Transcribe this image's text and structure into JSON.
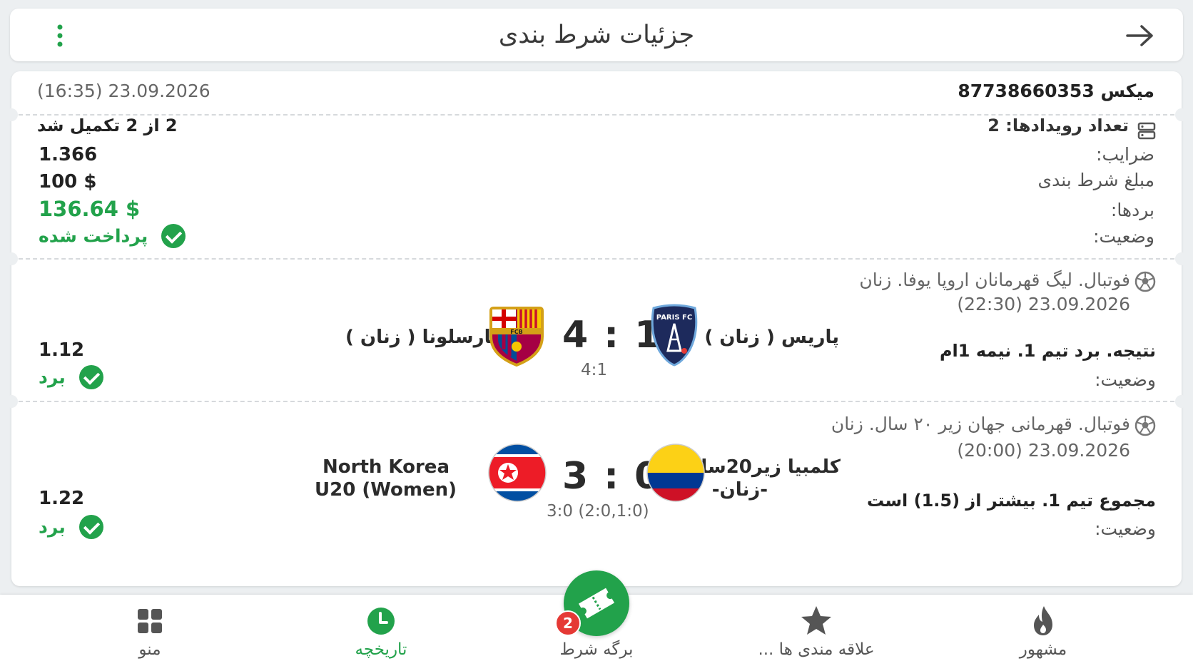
{
  "header": {
    "title": "جزئیات شرط بندی",
    "back_icon": "arrow-right-icon",
    "menu_icon": "kebab-menu-icon"
  },
  "bet": {
    "type_id": "میکس 87738660353",
    "datetime": "(16:35) 23.09.2026",
    "events_label": "تعداد رویدادها: 2",
    "completed": "2 از 2 تکمیل شد",
    "odds_label": "ضرایب:",
    "odds_value": "1.366",
    "stake_label": "مبلغ شرط بندی",
    "stake_value": "100 $",
    "winnings_label": "بردها:",
    "winnings_value": "136.64 $",
    "status_label": "وضعیت:",
    "status_value": "پرداخت شده"
  },
  "events": [
    {
      "league": "فوتبال. لیگ قهرمانان اروپا یوفا. زنان",
      "datetime": "(22:30) 23.09.2026",
      "home_team": "پاریس ( زنان )",
      "away_team": "بارسلونا ( زنان )",
      "score": "4 : 1",
      "sub_score": "4:1",
      "market": "نتیجه. برد تیم 1. نیمه 1ام",
      "status_label": "وضعیت:",
      "odds": "1.12",
      "result": "برد",
      "home_logo": "PARIS FC",
      "away_logo": "FCB"
    },
    {
      "league": "فوتبال. قهرمانی جهان زیر ۲۰ سال. زنان",
      "datetime": "(20:00) 23.09.2026",
      "home_team_line1": "کلمبیا زیر20سال",
      "home_team_line2": "-زنان-",
      "away_team_line1": "North Korea",
      "away_team_line2": "U20 (Women)",
      "score": "3 : 0",
      "sub_score": "3:0 (2:0,1:0)",
      "market": "مجموع تیم 1. بیشتر از (1.5) است",
      "status_label": "وضعیت:",
      "odds": "1.22",
      "result": "برد"
    }
  ],
  "bottom_nav": {
    "items": [
      {
        "label": "منو",
        "icon": "grid-icon"
      },
      {
        "label": "تاریخچه",
        "icon": "clock-icon"
      },
      {
        "label": "برگه شرط",
        "icon": "ticket-icon"
      },
      {
        "label": "علاقه مندی ها ...",
        "icon": "star-icon"
      },
      {
        "label": "مشهور",
        "icon": "flame-icon"
      }
    ],
    "betslip_count": "2"
  },
  "colors": {
    "accent": "#22a24b",
    "badge": "#e53935",
    "background": "#eceff1"
  }
}
